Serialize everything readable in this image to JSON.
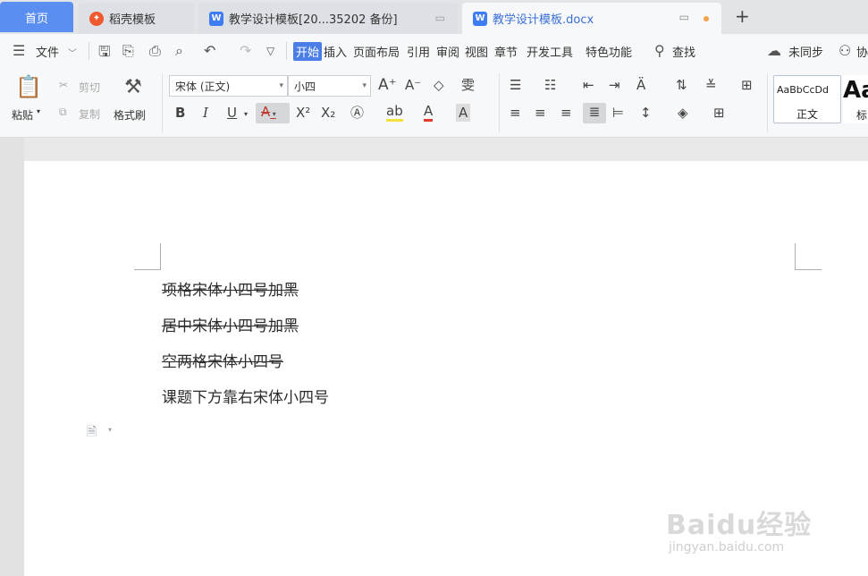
{
  "tabs": {
    "home": "首页",
    "shell_templates": "稻壳模板",
    "backup_doc": "教学设计模板[20...35202 备份]",
    "current_doc": "教学设计模板.docx",
    "new_tab": "+"
  },
  "menu": {
    "file": "文件",
    "items": [
      "开始",
      "插入",
      "页面布局",
      "引用",
      "审阅",
      "视图",
      "章节",
      "开发工具",
      "特色功能"
    ],
    "search": "查找",
    "sync": "未同步",
    "collab": "协"
  },
  "ribbon": {
    "paste": "粘贴",
    "cut": "剪切",
    "copy": "复制",
    "format_painter": "格式刷",
    "font_name": "宋体 (正文)",
    "font_size": "小四",
    "style_preview": "AaBbCcDd",
    "style_normal": "正文",
    "style_heading_preview": "Aa",
    "style_heading": "标"
  },
  "document": {
    "lines": [
      {
        "text": "项格宋体小四号加黑",
        "strike": true
      },
      {
        "text": "居中宋体小四号加黑",
        "strike": true
      },
      {
        "text": "空两格宋体小四号",
        "strike": true
      },
      {
        "text": "课题下方靠右宋体小四号",
        "strike": false
      }
    ]
  },
  "watermark": {
    "brand": "Baidu经验",
    "url": "jingyan.baidu.com"
  }
}
